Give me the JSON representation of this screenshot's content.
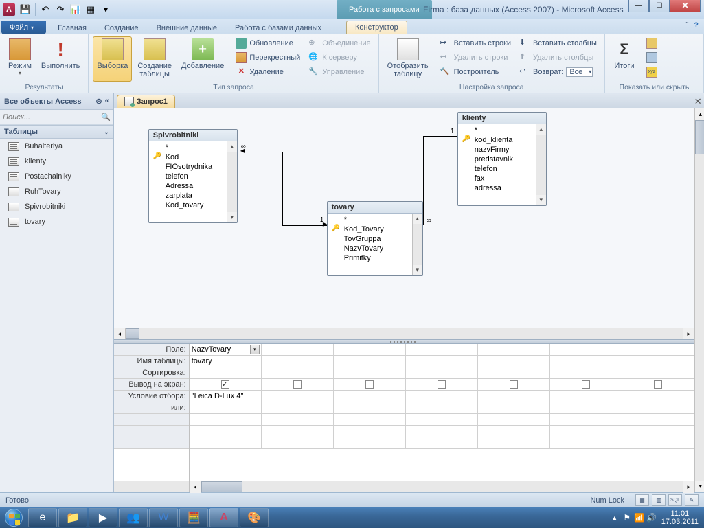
{
  "title": {
    "context": "Работа с запросами",
    "text": "Firma : база данных (Access 2007)  -  Microsoft Access"
  },
  "tabs": {
    "file": "Файл",
    "home": "Главная",
    "create": "Создание",
    "external": "Внешние данные",
    "dbtools": "Работа с базами данных",
    "design": "Конструктор"
  },
  "ribbon": {
    "results": {
      "label": "Результаты",
      "view": "Режим",
      "run": "Выполнить"
    },
    "qtype": {
      "label": "Тип запроса",
      "select": "Выборка",
      "maketable": "Создание\nтаблицы",
      "append": "Добавление",
      "update": "Обновление",
      "crosstab": "Перекрестный",
      "delete": "Удаление",
      "union": "Объединение",
      "passthrough": "К серверу",
      "datadef": "Управление"
    },
    "setup": {
      "label": "Настройка запроса",
      "showtable": "Отобразить\nтаблицу",
      "insertrows": "Вставить строки",
      "deleterows": "Удалить строки",
      "builder": "Построитель",
      "insertcols": "Вставить столбцы",
      "deletecols": "Удалить столбцы",
      "return_lbl": "Возврат:",
      "return_val": "Все"
    },
    "showhide": {
      "label": "Показать или скрыть",
      "totals": "Итоги"
    }
  },
  "help_tooltip": {
    "min": "ˇ",
    "help": "?"
  },
  "nav": {
    "header": "Все объекты Access",
    "search_ph": "Поиск...",
    "section": "Таблицы",
    "items": [
      "Buhalteriya",
      "klienty",
      "Postachalniky",
      "RuhTovary",
      "Spivrobitniki",
      "tovary"
    ]
  },
  "doc": {
    "tab_name": "Запрос1"
  },
  "tables": {
    "spiv": {
      "title": "Spivrobitniki",
      "fields": [
        "*",
        "Kod",
        "FIOsotrydnika",
        "telefon",
        "Adressa",
        "zarplata",
        "Kod_tovary"
      ],
      "key_index": 1
    },
    "tovary": {
      "title": "tovary",
      "fields": [
        "*",
        "Kod_Tovary",
        "TovGruppa",
        "NazvTovary",
        "Primitky"
      ],
      "key_index": 1
    },
    "klienty": {
      "title": "klienty",
      "fields": [
        "*",
        "kod_klienta",
        "nazvFirmy",
        "predstavnik",
        "telefon",
        "fax",
        "adressa"
      ],
      "key_index": 1
    }
  },
  "rel": {
    "one": "1",
    "many": "∞"
  },
  "qbe": {
    "labels": {
      "field": "Поле:",
      "table": "Имя таблицы:",
      "sort": "Сортировка:",
      "show": "Вывод на экран:",
      "criteria": "Условие отбора:",
      "or": "или:"
    },
    "col0": {
      "field": "NazvTovary",
      "table": "tovary",
      "criteria": "\"Leica D-Lux 4\""
    }
  },
  "status": {
    "ready": "Готово",
    "numlock": "Num Lock"
  },
  "clock": {
    "time": "11:01",
    "date": "17.03.2011"
  }
}
